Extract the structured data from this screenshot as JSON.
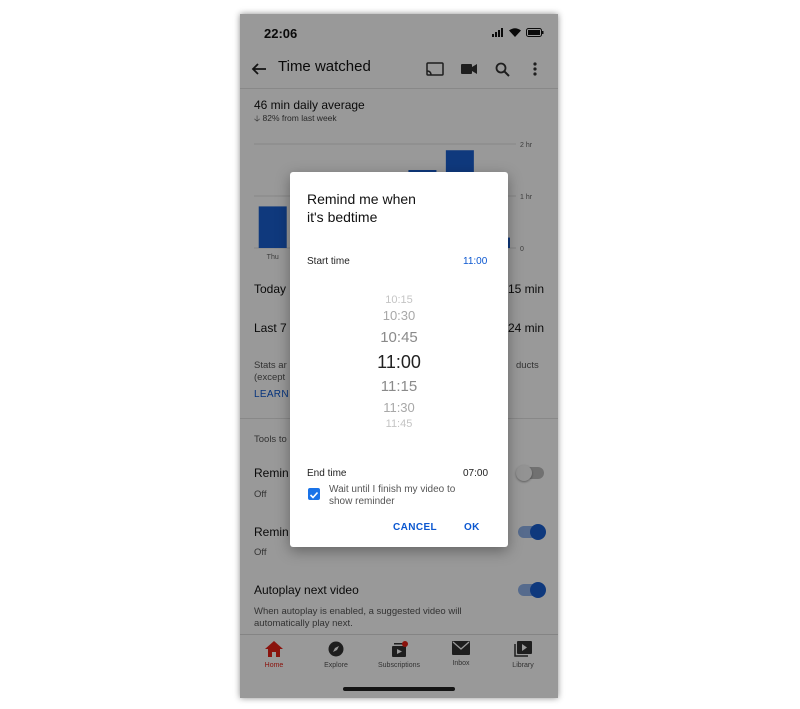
{
  "status_bar": {
    "time": "22:06"
  },
  "app_bar": {
    "title": "Time watched"
  },
  "summary": {
    "daily_average": "46 min daily average",
    "change": "82% from last week"
  },
  "chart_data": {
    "type": "bar",
    "categories": [
      "Thu",
      "",
      "",
      "",
      "",
      "",
      ""
    ],
    "values": [
      0.8,
      0,
      0,
      0,
      1.5,
      1.88,
      0.2
    ],
    "y_ticks": [
      "2 hr",
      "1 hr",
      "0"
    ],
    "ylim": [
      0,
      2
    ],
    "colors": {
      "bar": "#1a5fd0"
    }
  },
  "stats": {
    "today_label": "Today",
    "today_value": "15 min",
    "last7_label": "Last 7",
    "last7_value": "24 min",
    "note_start": "Stats ar",
    "note_start2": "(except",
    "note_end": "ducts",
    "learn_more": "LEARN M"
  },
  "tools": {
    "header": "Tools to",
    "reminder1_label": "Remin",
    "reminder1_sub": "Off",
    "reminder2_label": "Remin",
    "reminder2_sub": "Off",
    "autoplay_label": "Autoplay next video",
    "autoplay_desc_1": "When autoplay is enabled, a suggested video will",
    "autoplay_desc_2": "automatically play next."
  },
  "bottom_nav": {
    "home": "Home",
    "explore": "Explore",
    "subscriptions": "Subscriptions",
    "inbox": "Inbox",
    "library": "Library"
  },
  "dialog": {
    "title_line1": "Remind me when",
    "title_line2": "it's bedtime",
    "start_label": "Start time",
    "start_value": "11:00",
    "picker_options": [
      "10:15",
      "10:30",
      "10:45",
      "11:00",
      "11:15",
      "11:30",
      "11:45"
    ],
    "end_label": "End time",
    "end_value": "07:00",
    "checkbox_label_1": "Wait until I finish my video to",
    "checkbox_label_2": "show reminder",
    "cancel": "CANCEL",
    "ok": "OK"
  },
  "colors": {
    "accent": "#0b57d0",
    "home_red": "#e62117",
    "toggle_on": "#1a5fd0"
  }
}
